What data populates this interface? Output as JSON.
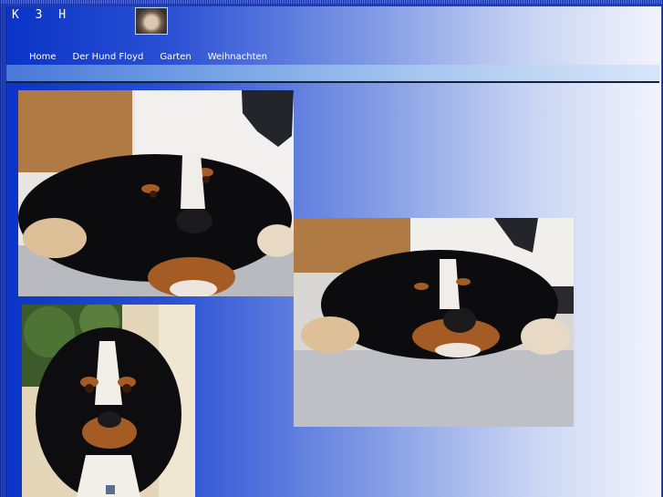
{
  "header": {
    "site_title": "K 3 H"
  },
  "nav": {
    "items": [
      "Home",
      "Der Hund Floyd",
      "Garten",
      "Weihnachten"
    ]
  },
  "colors": {
    "page_gradient_start": "#0a34c6",
    "page_gradient_end": "#f3f5fc",
    "nav_bar": "#7aa7e6"
  },
  "photos": [
    {
      "subject": "Bernese mountain dog lying on carpet"
    },
    {
      "subject": "Bernese mountain dog lying on carpet, closer"
    },
    {
      "subject": "Bernese mountain dog puppy portrait"
    }
  ]
}
